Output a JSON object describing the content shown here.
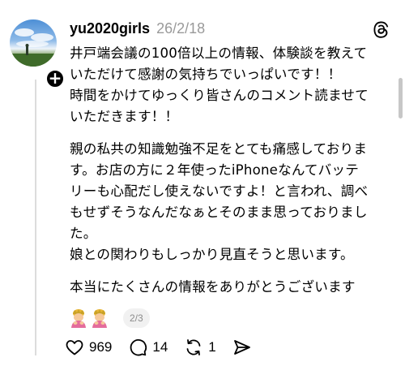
{
  "post": {
    "username": "yu2020girls",
    "timestamp": "26/2/18",
    "body": {
      "p1": "井戸端会議の100倍以上の情報、体験談を教えて\nいただけて感謝の気持ちでいっぱいです！！",
      "p2": "時間をかけてゆっくり皆さんのコメント読ませて\nいただきます！！",
      "p3": "親の私共の知識勉強不足をとても痛感しておりま\nす。お店の方に２年使ったiPhoneなんてバッテ\nリーも心配だし使えないですよ！と言われ、調べ\nもせずそうなんだなぁとそのまま思っておりまし\nた。",
      "p4": "娘との関わりもしっかり見直そうと思います。",
      "p5": "本当にたくさんの情報をありがとうございます"
    },
    "emojis": [
      "woman-bowing-icon",
      "woman-bowing-icon"
    ],
    "page_indicator": "2/3"
  },
  "actions": {
    "likes": "969",
    "replies": "14",
    "reposts": "1"
  }
}
